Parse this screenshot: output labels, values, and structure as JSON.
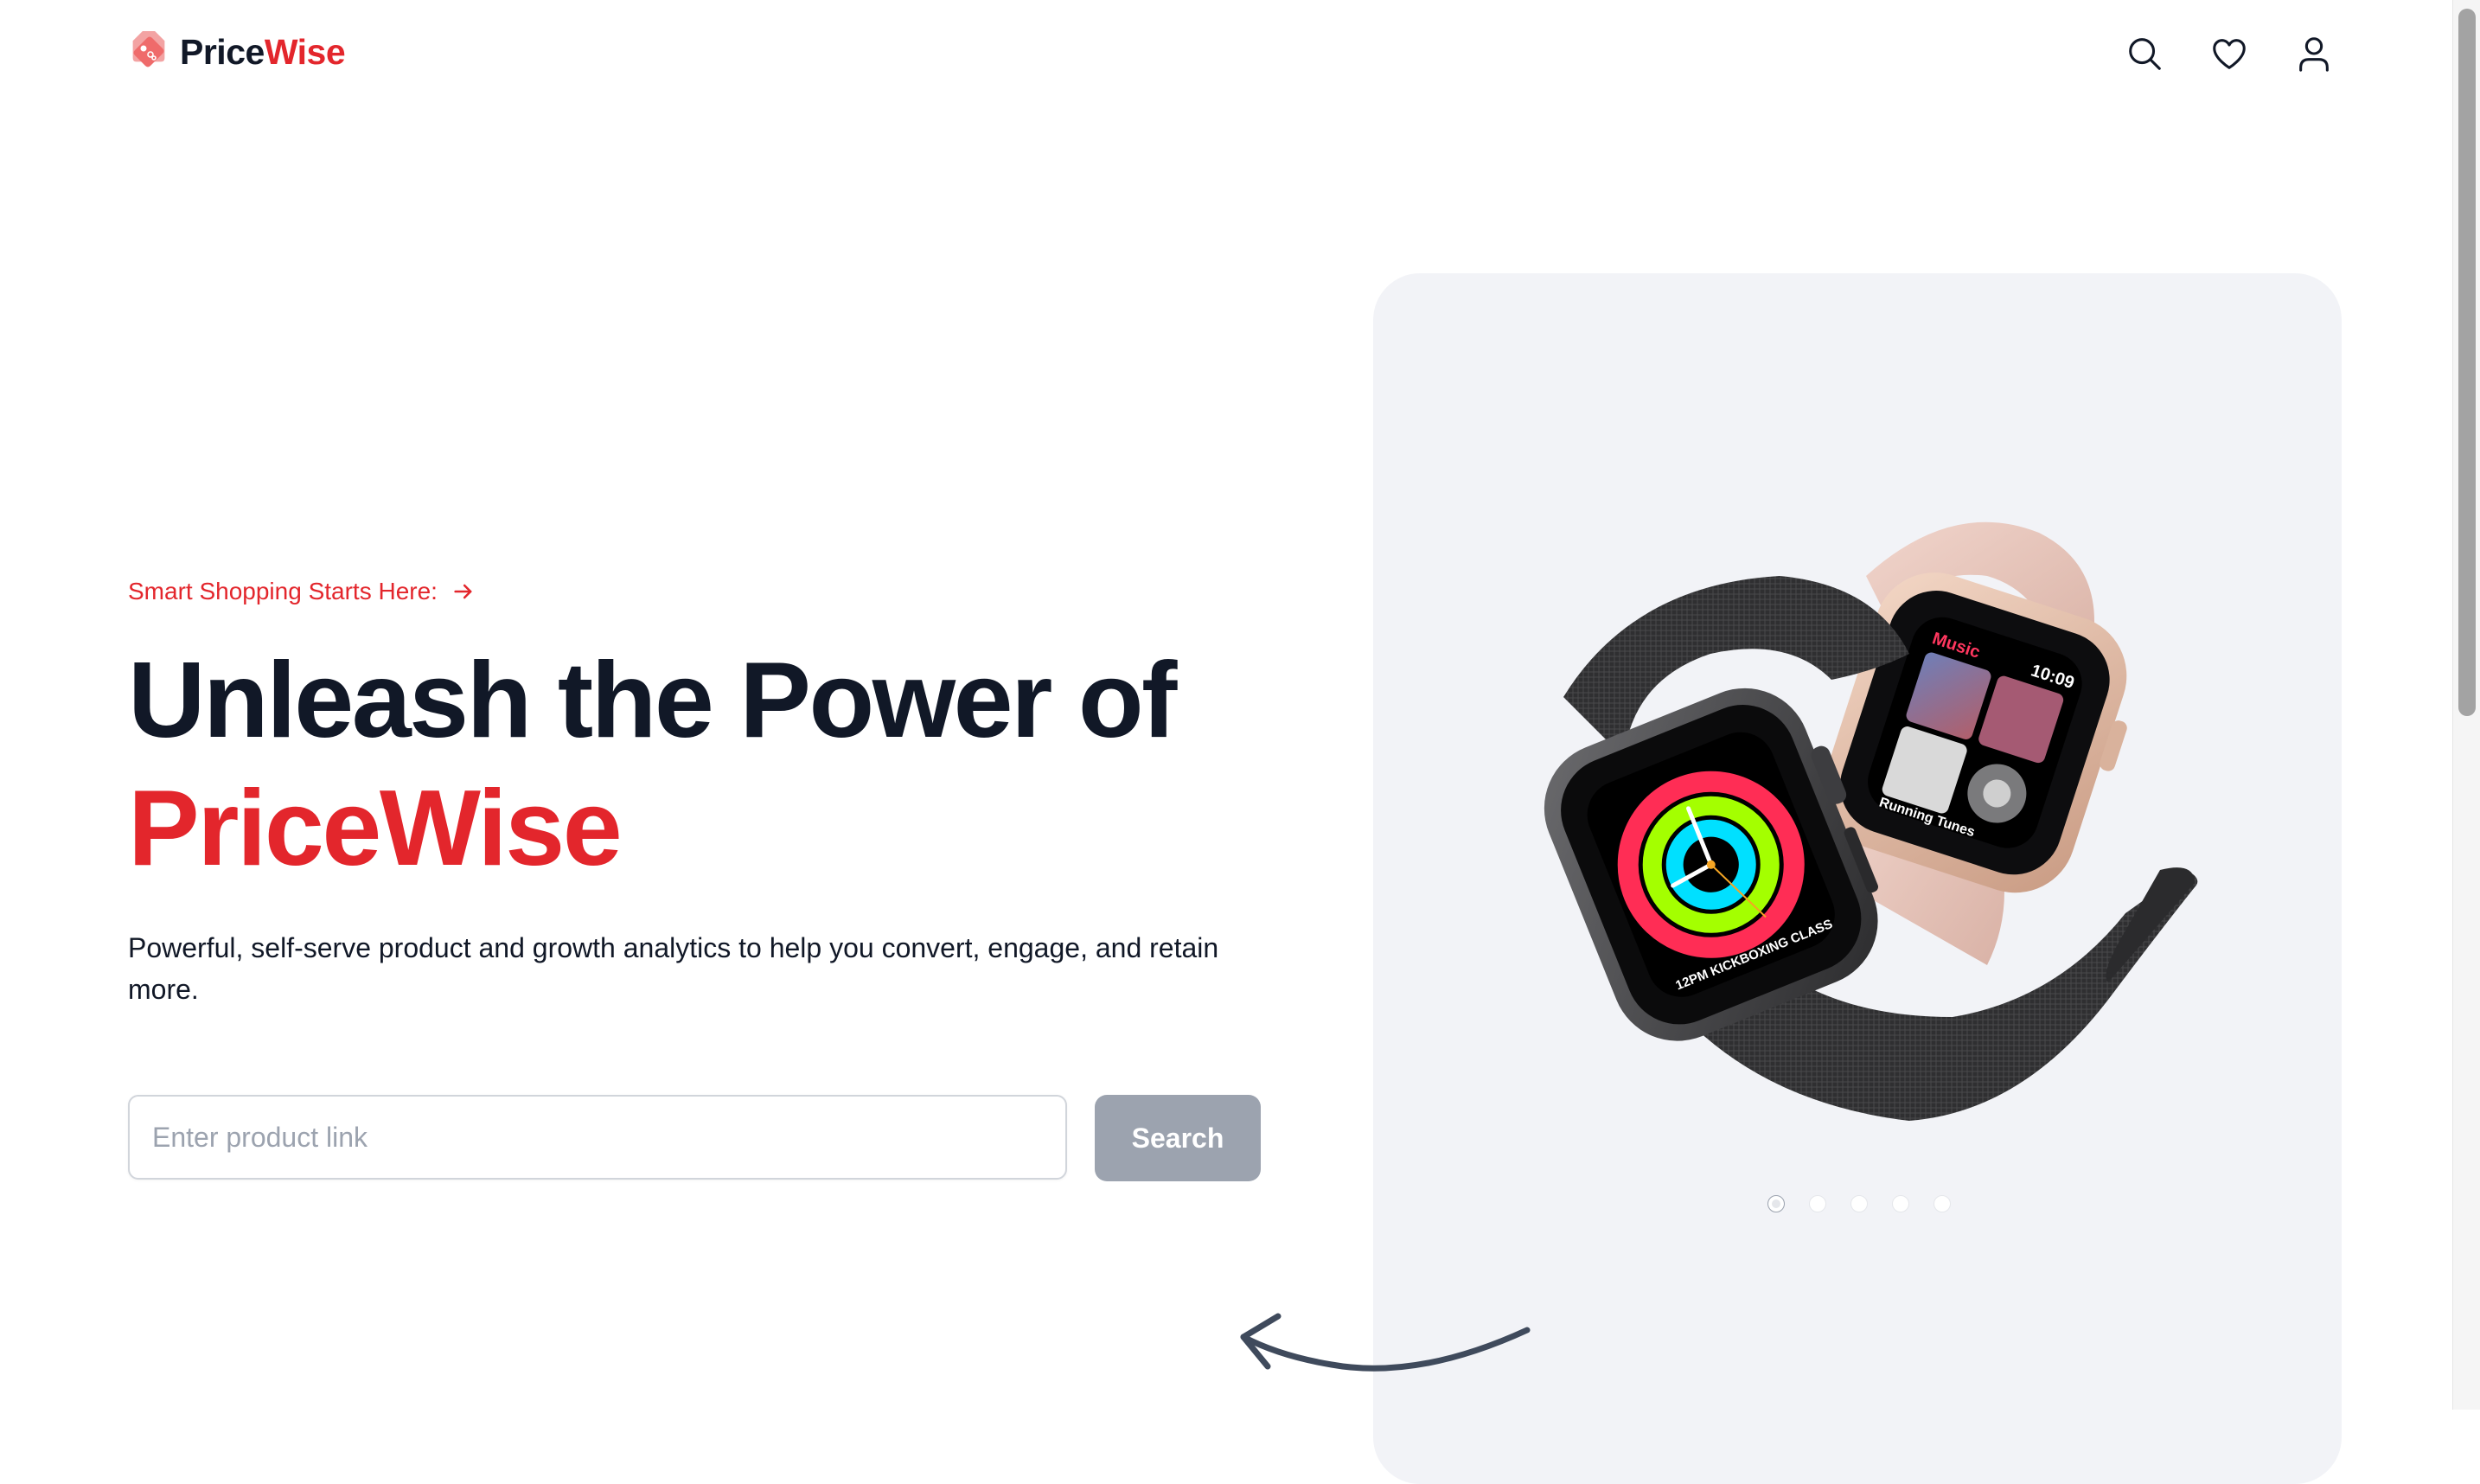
{
  "brand": {
    "name_part1": "Price",
    "name_part2": "Wise",
    "accent_color": "#e3262c"
  },
  "nav": {
    "icons": [
      "search-icon",
      "heart-icon",
      "user-icon"
    ]
  },
  "hero": {
    "tagline": "Smart Shopping Starts Here:",
    "headline_line1": "Unleash the Power of",
    "headline_brand": "PriceWise",
    "subtitle": "Powerful, self-serve product and growth analytics to help you convert, engage, and retain more."
  },
  "search": {
    "placeholder": "Enter product link",
    "value": "",
    "button_label": "Search"
  },
  "carousel": {
    "image": "smartwatch-product-image",
    "total_slides": 5,
    "active_slide": 1,
    "watch_screen_texts": {
      "music_label": "Music",
      "time": "10:09",
      "song": "Running Tunes",
      "class_label": "12PM KICKBOXING CLASS"
    }
  }
}
